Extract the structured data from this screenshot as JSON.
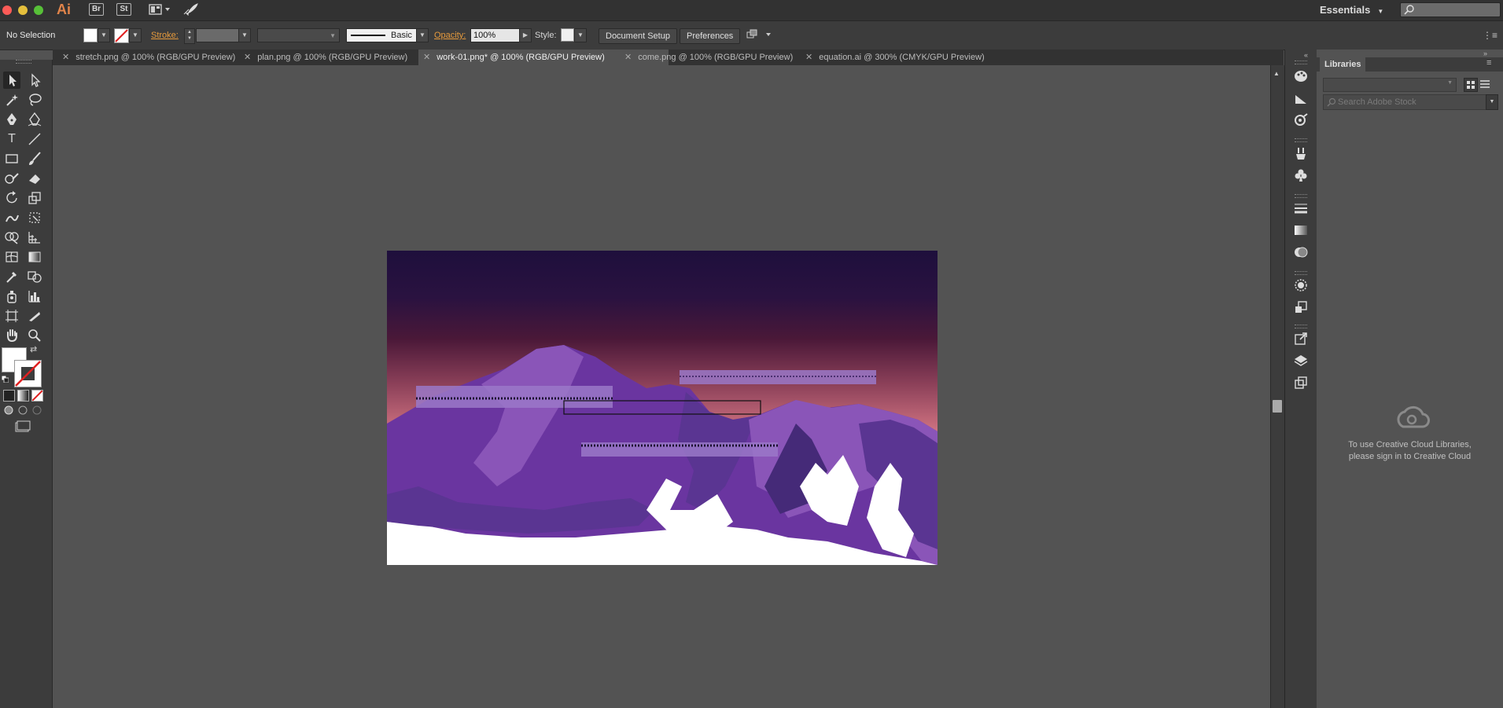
{
  "app": {
    "logo": "Ai",
    "bridge_label": "Br",
    "stock_label": "St",
    "workspace": "Essentials",
    "colors": {
      "logo": "#e1844a",
      "close": "#fc5b57",
      "minimize": "#e5bf3c",
      "zoom": "#57c038"
    }
  },
  "control_bar": {
    "selection": "No Selection",
    "stroke_label": "Stroke:",
    "brush_label": "Basic",
    "opacity_label": "Opacity:",
    "opacity_value": "100%",
    "style_label": "Style:",
    "document_setup": "Document Setup",
    "preferences": "Preferences"
  },
  "tabs": [
    {
      "label": "stretch.png @ 100% (RGB/GPU Preview)"
    },
    {
      "label": "plan.png @ 100% (RGB/GPU Preview)"
    },
    {
      "label": "work-01.png* @ 100% (RGB/GPU Preview)",
      "active": true
    },
    {
      "label": "come.png @ 100% (RGB/GPU Preview)"
    },
    {
      "label": "equation.ai @ 300% (CMYK/GPU Preview)"
    }
  ],
  "tools": [
    "selection-icon",
    "direct-selection-icon",
    "magic-wand-icon",
    "lasso-icon",
    "pen-icon",
    "curvature-icon",
    "type-icon",
    "line-icon",
    "rectangle-icon",
    "paintbrush-icon",
    "shaper-icon",
    "eraser-icon",
    "rotate-icon",
    "scale-icon",
    "warp-icon",
    "free-transform-icon",
    "shape-builder-icon",
    "perspective-grid-icon",
    "mesh-icon",
    "gradient-icon",
    "eyedropper-icon",
    "blend-icon",
    "symbol-sprayer-icon",
    "column-graph-icon",
    "artboard-icon",
    "slice-icon",
    "hand-icon",
    "zoom-icon"
  ],
  "libraries": {
    "title": "Libraries",
    "search_placeholder": "Search Adobe Stock",
    "signin_line1": "To use Creative Cloud Libraries,",
    "signin_line2": "please sign in to Creative Cloud"
  },
  "artwork": {
    "sky_colors": [
      "#1e0f3c",
      "#4a1838",
      "#c46a7a",
      "#f0a3a8"
    ],
    "mountain_colors": [
      "#6a35a0",
      "#8a55b8",
      "#452a78",
      "#5a3592"
    ]
  }
}
